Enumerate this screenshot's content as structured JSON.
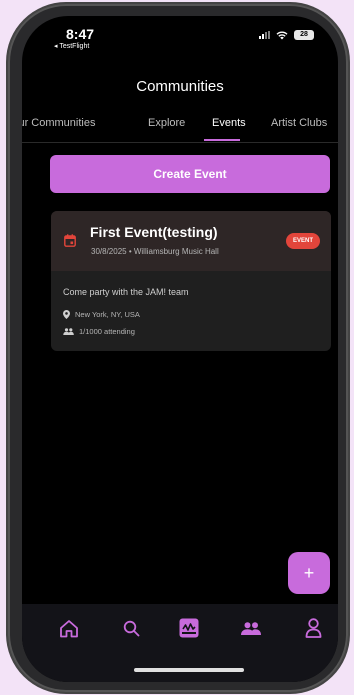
{
  "status_bar": {
    "time": "8:47",
    "back_app": "◂ TestFlight",
    "battery": "28"
  },
  "header": {
    "title": "Communities"
  },
  "tabs": [
    {
      "label": "Your Communities"
    },
    {
      "label": "Explore"
    },
    {
      "label": "Events",
      "active": true
    },
    {
      "label": "Artist Clubs"
    }
  ],
  "create_button": {
    "label": "Create Event"
  },
  "event": {
    "title": "First Event(testing)",
    "subtitle": "30/8/2025 • Williamsburg Music Hall",
    "badge": "EVENT",
    "description": "Come party with the JAM! team",
    "location": "New York, NY, USA",
    "attending": "1/1000 attending"
  },
  "fab": {
    "icon": "plus-icon",
    "label": "+"
  },
  "bottom_nav": [
    {
      "icon": "home-icon"
    },
    {
      "icon": "search-icon"
    },
    {
      "icon": "jam-logo-icon",
      "active": true
    },
    {
      "icon": "people-icon"
    },
    {
      "icon": "profile-icon"
    }
  ],
  "colors": {
    "accent": "#c86bdc",
    "badge": "#e2453b",
    "background": "#000000",
    "card": "#1f1f1f",
    "page": "#f3e3f7"
  }
}
